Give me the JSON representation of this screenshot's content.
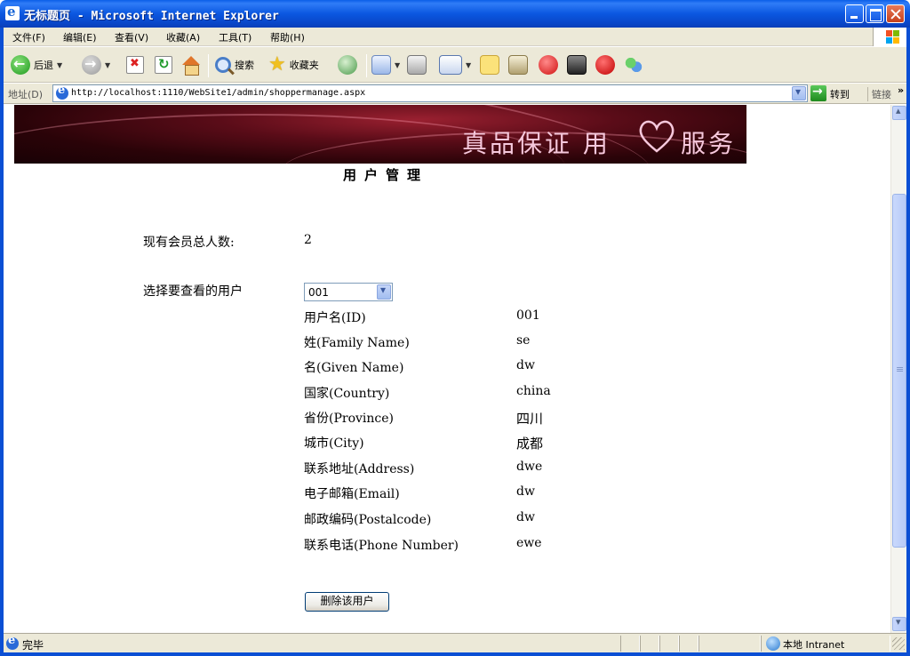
{
  "window": {
    "title": "无标题页 - Microsoft Internet Explorer"
  },
  "menu": {
    "items": [
      {
        "label": "文件(F)"
      },
      {
        "label": "编辑(E)"
      },
      {
        "label": "查看(V)"
      },
      {
        "label": "收藏(A)"
      },
      {
        "label": "工具(T)"
      },
      {
        "label": "帮助(H)"
      }
    ]
  },
  "toolbar": {
    "back_label": "后退",
    "search_label": "搜索",
    "favorites_label": "收藏夹"
  },
  "address": {
    "label": "地址(D)",
    "url": "http://localhost:1110/WebSite1/admin/shoppermanage.aspx",
    "go_label": "转到",
    "links_label": "链接",
    "more": "»"
  },
  "banner": {
    "slogan_part1": "真品保证 用",
    "slogan_part2": "服务"
  },
  "page": {
    "title": "用户管理",
    "member_count_label": "现有会员总人数:",
    "member_count": "2",
    "select_user_label": "选择要查看的用户",
    "selected_user": "001",
    "fields": [
      {
        "label": "用户名(ID)",
        "value": "001"
      },
      {
        "label": "姓(Family Name)",
        "value": "se"
      },
      {
        "label": "名(Given Name)",
        "value": "dw"
      },
      {
        "label": "国家(Country)",
        "value": "china"
      },
      {
        "label": "省份(Province)",
        "value": "四川"
      },
      {
        "label": "城市(City)",
        "value": "成都"
      },
      {
        "label": "联系地址(Address)",
        "value": "dwe"
      },
      {
        "label": "电子邮箱(Email)",
        "value": "dw"
      },
      {
        "label": "邮政编码(Postalcode)",
        "value": "dw"
      },
      {
        "label": "联系电话(Phone Number)",
        "value": "ewe"
      }
    ],
    "delete_button": "删除该用户"
  },
  "status": {
    "text": "完毕",
    "zone": "本地 Intranet"
  },
  "colors": {
    "titlebar": "#0b57e0",
    "chrome": "#ece9d8",
    "banner": "#5a0c18"
  }
}
